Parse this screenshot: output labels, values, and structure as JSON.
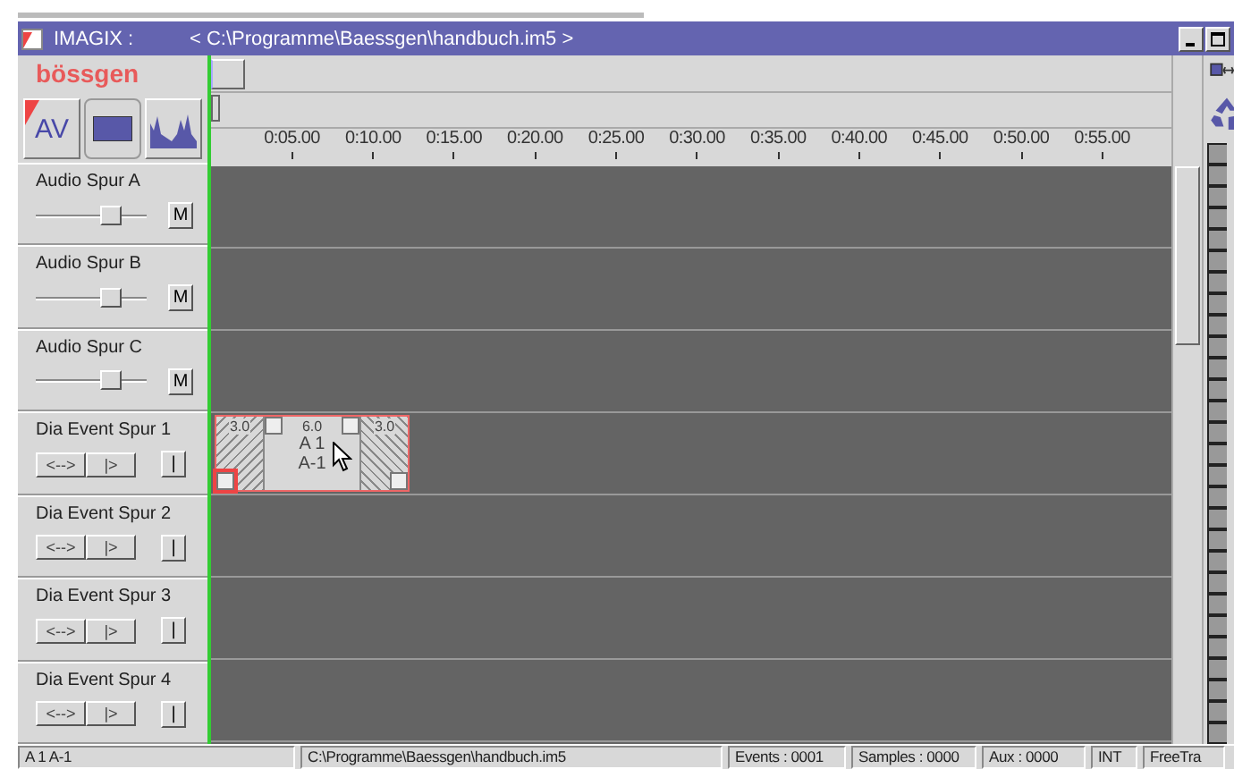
{
  "window": {
    "title": "IMAGIX :",
    "document": "< C:\\Programme\\Baessgen\\handbuch.im5 >"
  },
  "logo": "bössgen",
  "toolbar": [
    {
      "kind": "av",
      "label": "AV",
      "selected": false
    },
    {
      "kind": "rect",
      "selected": true
    },
    {
      "kind": "wave",
      "selected": false
    }
  ],
  "ruler": [
    "0:05.00",
    "0:10.00",
    "0:15.00",
    "0:20.00",
    "0:25.00",
    "0:30.00",
    "0:35.00",
    "0:40.00",
    "0:45.00",
    "0:50.00",
    "0:55.00"
  ],
  "tracks": [
    {
      "kind": "audio",
      "name": "Audio Spur A",
      "level": 0.68,
      "mute": "M"
    },
    {
      "kind": "audio",
      "name": "Audio Spur B",
      "level": 0.68,
      "mute": "M"
    },
    {
      "kind": "audio",
      "name": "Audio Spur C",
      "level": 0.68,
      "mute": "M"
    },
    {
      "kind": "event",
      "name": "Dia Event Spur 1",
      "buttons": [
        "<-->",
        "|>",
        "|"
      ],
      "clip": {
        "lead_in": "3.0",
        "duration": "6.0",
        "lead_out": "3.0",
        "line_1": "A 1",
        "line_2": "A-1"
      }
    },
    {
      "kind": "event",
      "name": "Dia Event Spur 2",
      "buttons": [
        "<-->",
        "|>",
        "|"
      ]
    },
    {
      "kind": "event",
      "name": "Dia Event Spur 3",
      "buttons": [
        "<-->",
        "|>",
        "|"
      ]
    },
    {
      "kind": "event",
      "name": "Dia Event Spur 4",
      "buttons": [
        "<-->",
        "|>",
        "|"
      ]
    }
  ],
  "status_bar": [
    "A 1 A-1",
    "C:\\Programme\\Baessgen\\handbuch.im5",
    "Events :  0001",
    "Samples :  0000",
    "Aux :  0000",
    "INT",
    "FreeTra"
  ]
}
